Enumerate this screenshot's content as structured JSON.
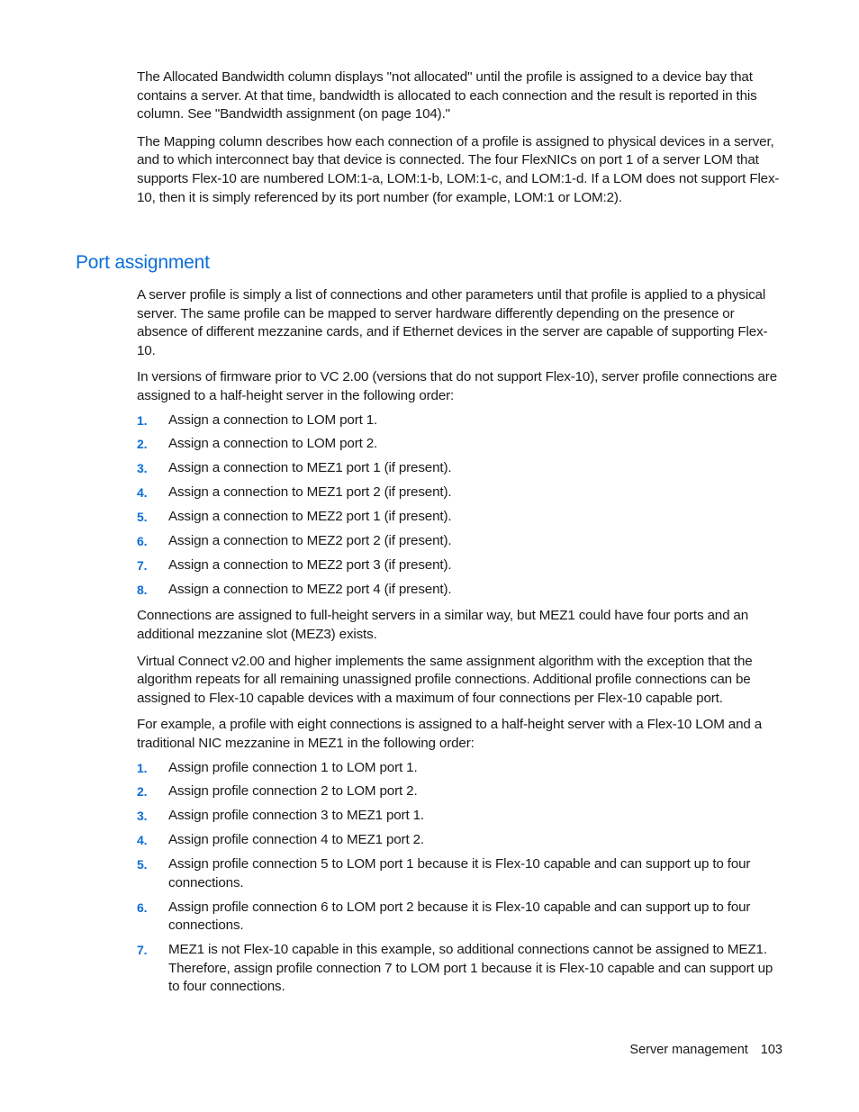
{
  "intro": {
    "p1": "The Allocated Bandwidth column displays \"not allocated\" until the profile is assigned to a device bay that contains a server. At that time, bandwidth is allocated to each connection and the result is reported in this column. See \"Bandwidth assignment (on page 104).\"",
    "p2": "The Mapping column describes how each connection of a profile is assigned to physical devices in a server, and to which interconnect bay that device is connected. The four FlexNICs on port 1 of a server LOM that supports Flex-10 are numbered LOM:1-a, LOM:1-b, LOM:1-c, and LOM:1-d. If a LOM does not support Flex-10, then it is simply referenced by its port number (for example, LOM:1 or LOM:2)."
  },
  "section": {
    "title": "Port assignment",
    "p1": "A server profile is simply a list of connections and other parameters until that profile is applied to a physical server. The same profile can be mapped to server hardware differently depending on the presence or absence of different mezzanine cards, and if Ethernet devices in the server are capable of supporting Flex-10.",
    "p2": "In versions of firmware prior to VC 2.00 (versions that do not support Flex-10), server profile connections are assigned to a half-height server in the following order:",
    "list1": [
      {
        "num": "1.",
        "text": "Assign a connection to LOM port 1."
      },
      {
        "num": "2.",
        "text": "Assign a connection to LOM port 2."
      },
      {
        "num": "3.",
        "text": "Assign a connection to MEZ1 port 1 (if present)."
      },
      {
        "num": "4.",
        "text": "Assign a connection to MEZ1 port 2 (if present)."
      },
      {
        "num": "5.",
        "text": "Assign a connection to MEZ2 port 1 (if present)."
      },
      {
        "num": "6.",
        "text": "Assign a connection to MEZ2 port 2 (if present)."
      },
      {
        "num": "7.",
        "text": "Assign a connection to MEZ2 port 3 (if present)."
      },
      {
        "num": "8.",
        "text": "Assign a connection to MEZ2 port 4 (if present)."
      }
    ],
    "p3": "Connections are assigned to full-height servers in a similar way, but MEZ1 could have four ports and an additional mezzanine slot (MEZ3) exists.",
    "p4": "Virtual Connect v2.00 and higher implements the same assignment algorithm with the exception that the algorithm repeats for all remaining unassigned profile connections. Additional profile connections can be assigned to Flex-10 capable devices with a maximum of four connections per Flex-10 capable port.",
    "p5": "For example, a profile with eight connections is assigned to a half-height server with a Flex-10 LOM and a traditional NIC mezzanine in MEZ1 in the following order:",
    "list2": [
      {
        "num": "1.",
        "text": "Assign profile connection 1 to LOM port 1."
      },
      {
        "num": "2.",
        "text": "Assign profile connection 2 to LOM port 2."
      },
      {
        "num": "3.",
        "text": "Assign profile connection 3 to MEZ1 port 1."
      },
      {
        "num": "4.",
        "text": "Assign profile connection 4 to MEZ1 port 2."
      },
      {
        "num": "5.",
        "text": "Assign profile connection 5 to LOM port 1 because it is Flex-10 capable and can support up to four connections."
      },
      {
        "num": "6.",
        "text": "Assign profile connection 6 to LOM port 2 because it is Flex-10 capable and can support up to four connections."
      },
      {
        "num": "7.",
        "text": "MEZ1 is not Flex-10 capable in this example, so additional connections cannot be assigned to MEZ1. Therefore, assign profile connection 7 to LOM port 1 because it is Flex-10 capable and can support up to four connections."
      }
    ]
  },
  "footer": {
    "chapter": "Server management",
    "page": "103"
  },
  "colors": {
    "accent": "#0b6ed8",
    "text": "#1a1a1a"
  }
}
